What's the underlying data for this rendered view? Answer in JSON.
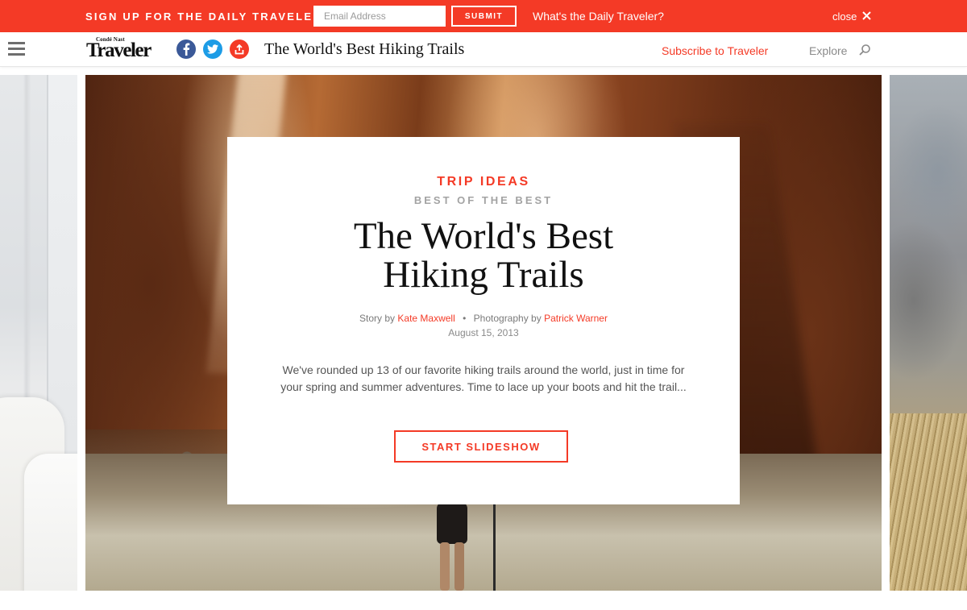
{
  "signup": {
    "text": "Sign up for the Daily Traveler",
    "email_placeholder": "Email Address",
    "submit_label": "Submit",
    "whats_link": "What's the Daily Traveler?",
    "close_label": "close",
    "bar_color": "#f43a26"
  },
  "nav": {
    "logo_small": "Condé Nast",
    "logo_main": "Traveler",
    "page_title": "The World's Best Hiking Trails",
    "subscribe_label": "Subscribe to Traveler",
    "explore_label": "Explore",
    "icons": {
      "menu": "hamburger-menu-icon",
      "facebook": "facebook-icon",
      "twitter": "twitter-icon",
      "share": "share-icon",
      "search": "search-icon",
      "close": "close-icon"
    }
  },
  "card": {
    "eyebrow": "Trip Ideas",
    "sub_eyebrow": "Best of the Best",
    "title_line1": "The World's Best",
    "title_line2": "Hiking Trails",
    "story_prefix": "Story by",
    "author": "Kate Maxwell",
    "separator": "•",
    "photo_prefix": "Photography by",
    "photographer": "Patrick Warner",
    "date": "August 15, 2013",
    "dek": "We've rounded up 13 of our favorite hiking trails around the world, just in time for your spring and summer adventures. Time to lace up your boots and hit the trail...",
    "button_label": "Start Slideshow"
  },
  "colors": {
    "accent": "#f43a26",
    "facebook": "#3b5998",
    "twitter": "#1d9ce6"
  }
}
